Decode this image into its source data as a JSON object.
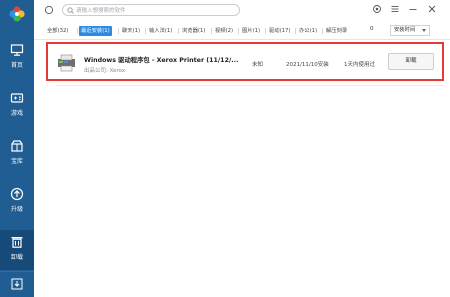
{
  "sidebar": {
    "items": [
      {
        "label": "首页",
        "icon": "monitor-icon"
      },
      {
        "label": "游戏",
        "icon": "gamepad-icon"
      },
      {
        "label": "宝库",
        "icon": "treasure-icon"
      },
      {
        "label": "升级",
        "icon": "upgrade-icon"
      },
      {
        "label": "卸载",
        "icon": "trash-icon"
      }
    ],
    "bottom_icon": "download-icon",
    "active_index": 4
  },
  "search": {
    "placeholder": "请输入想搜索的软件"
  },
  "filters": [
    {
      "label": "全部(32)"
    },
    {
      "label": "最近安装(1)"
    },
    {
      "label": "聊天(1)"
    },
    {
      "label": "输入法(1)"
    },
    {
      "label": "浏览器(1)"
    },
    {
      "label": "视频(2)"
    },
    {
      "label": "图片(1)"
    },
    {
      "label": "驱动(17)"
    },
    {
      "label": "办公(1)"
    },
    {
      "label": "解压刻录"
    }
  ],
  "active_filter": 1,
  "count": "0",
  "sort": {
    "selected": "安装时间"
  },
  "app": {
    "name": "Windows 驱动程序包 - Xerox Printer  (11/12/...",
    "publisher": "出品公司: Xerox",
    "size": "未知",
    "install_date": "2021/11/10安装",
    "usage": "1天内使用过",
    "uninstall_label": "卸载"
  },
  "colors": {
    "sidebar": "#1f5d92",
    "sidebar_active": "#164a78",
    "accent": "#2c8be0",
    "highlight_border": "#e23a35"
  }
}
